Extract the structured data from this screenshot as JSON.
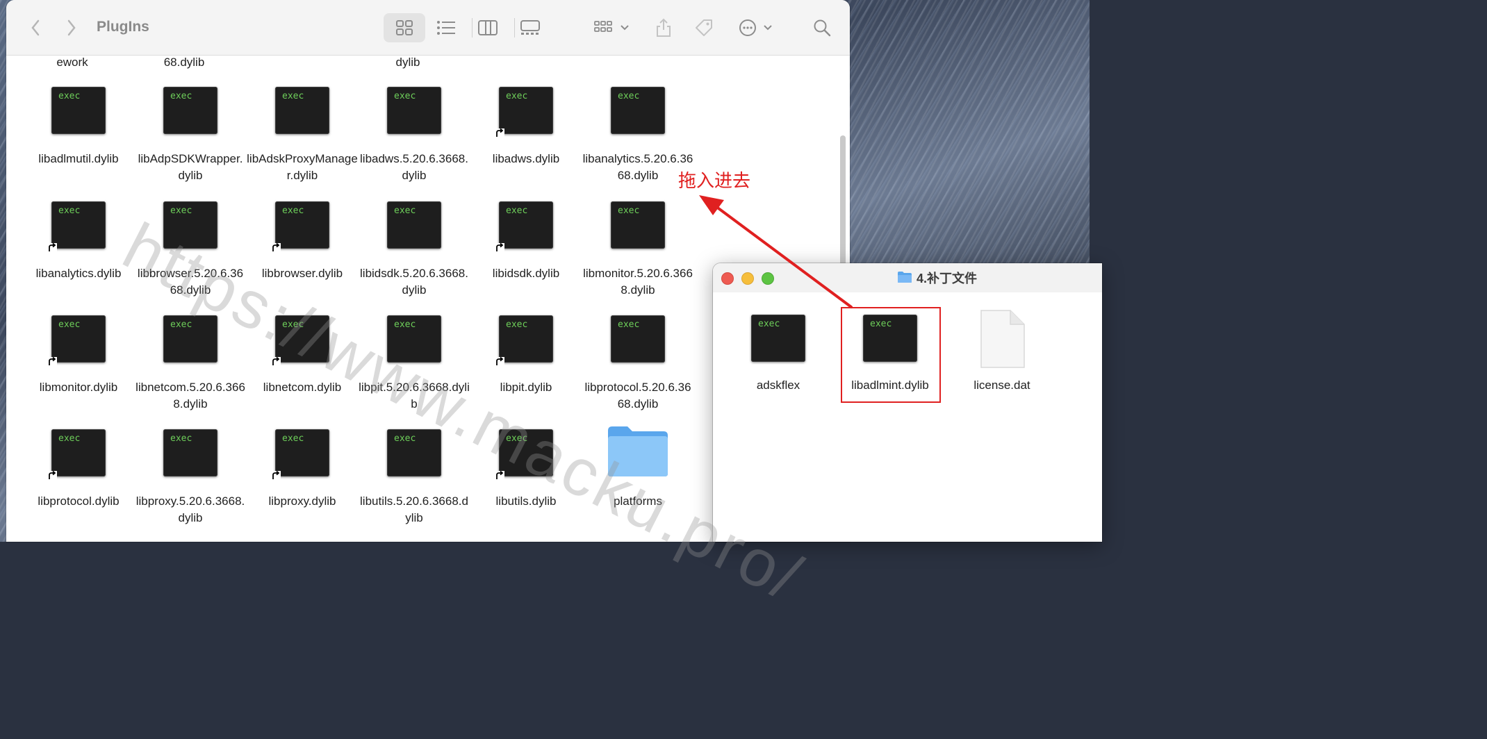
{
  "finder": {
    "title": "PlugIns",
    "top_row_labels": [
      "ework",
      "68.dylib",
      "dylib"
    ],
    "items": [
      {
        "label": "libadlmutil.dylib",
        "alias": false
      },
      {
        "label": "libAdpSDKWrapper.dylib",
        "alias": false
      },
      {
        "label": "libAdskProxyManager.dylib",
        "alias": false
      },
      {
        "label": "libadws.5.20.6.3668.dylib",
        "alias": false
      },
      {
        "label": "libadws.dylib",
        "alias": true
      },
      {
        "label": "libanalytics.5.20.6.3668.dylib",
        "alias": false
      },
      {
        "label": "libanalytics.dylib",
        "alias": true
      },
      {
        "label": "libbrowser.5.20.6.3668.dylib",
        "alias": false
      },
      {
        "label": "libbrowser.dylib",
        "alias": true
      },
      {
        "label": "libidsdk.5.20.6.3668.dylib",
        "alias": false
      },
      {
        "label": "libidsdk.dylib",
        "alias": true
      },
      {
        "label": "libmonitor.5.20.6.3668.dylib",
        "alias": false
      },
      {
        "label": "libmonitor.dylib",
        "alias": true
      },
      {
        "label": "libnetcom.5.20.6.3668.dylib",
        "alias": false
      },
      {
        "label": "libnetcom.dylib",
        "alias": true
      },
      {
        "label": "libpit.5.20.6.3668.dylib",
        "alias": false
      },
      {
        "label": "libpit.dylib",
        "alias": true
      },
      {
        "label": "libprotocol.5.20.6.3668.dylib",
        "alias": false
      },
      {
        "label": "libprotocol.dylib",
        "alias": true
      },
      {
        "label": "libproxy.5.20.6.3668.dylib",
        "alias": false
      },
      {
        "label": "libproxy.dylib",
        "alias": true
      },
      {
        "label": "libutils.5.20.6.3668.dylib",
        "alias": false
      },
      {
        "label": "libutils.dylib",
        "alias": true
      },
      {
        "label": "platforms",
        "alias": false,
        "folder": true
      }
    ],
    "exec_badge": "exec"
  },
  "patch_window": {
    "title": "4.补丁文件",
    "items": [
      {
        "label": "adskflex",
        "kind": "exec"
      },
      {
        "label": "libadlmint.dylib",
        "kind": "exec",
        "highlighted": true
      },
      {
        "label": "license.dat",
        "kind": "document"
      }
    ]
  },
  "annotation": {
    "text": "拖入进去",
    "color": "#e02020"
  },
  "watermark": "https://www.macku.pro/",
  "colors": {
    "folder_blue": "#7ab8f5",
    "exec_green": "#6ecf5a"
  }
}
